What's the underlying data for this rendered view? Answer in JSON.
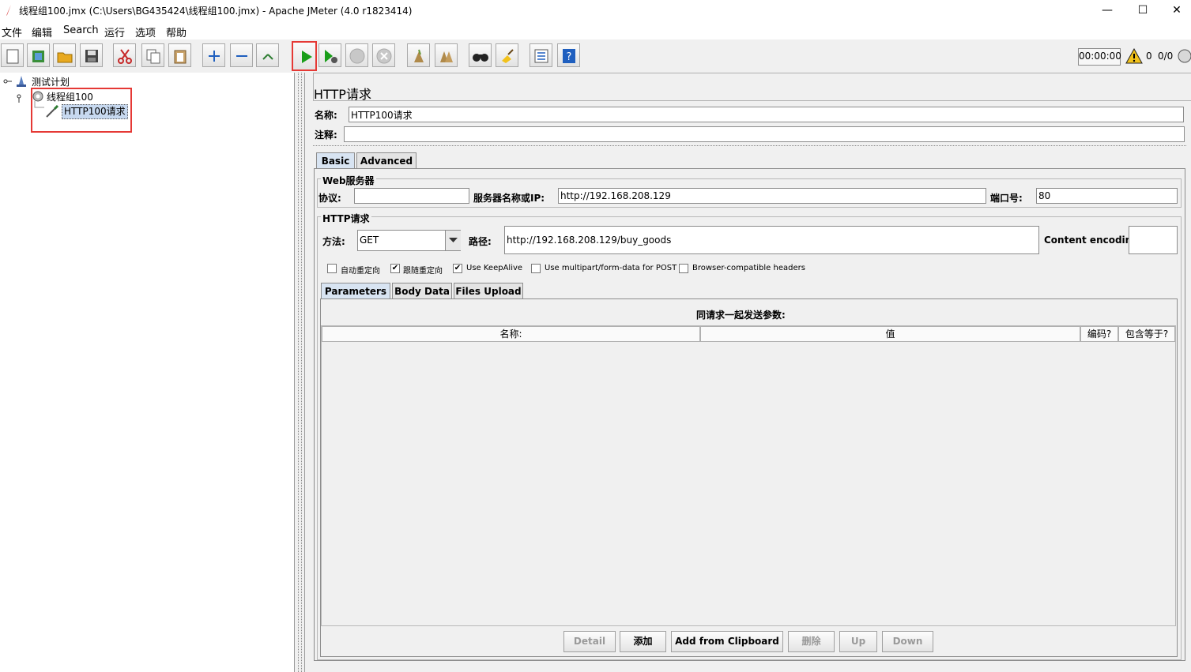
{
  "window": {
    "title": "线程组100.jmx (C:\\Users\\BG435424\\线程组100.jmx) - Apache JMeter (4.0 r1823414)",
    "minimize": "—",
    "maximize": "☐",
    "close": "✕"
  },
  "menu": [
    "文件",
    "编辑",
    "Search",
    "运行",
    "选项",
    "帮助"
  ],
  "toolbar": {
    "timer": "00:00:00",
    "warnings": "0",
    "threads": "0/0"
  },
  "tree": {
    "root": "测试计划",
    "thread_group": "线程组100",
    "sampler": "HTTP100请求"
  },
  "panel": {
    "title": "HTTP请求",
    "name_label": "名称:",
    "name_value": "HTTP100请求",
    "comment_label": "注释:",
    "comment_value": "",
    "tabs": [
      "Basic",
      "Advanced"
    ]
  },
  "web_server": {
    "section": "Web服务器",
    "protocol_label": "协议:",
    "protocol_value": "",
    "server_label": "服务器名称或IP:",
    "server_value": "http://192.168.208.129",
    "port_label": "端口号:",
    "port_value": "80"
  },
  "http_request": {
    "section": "HTTP请求",
    "method_label": "方法:",
    "method_value": "GET",
    "path_label": "路径:",
    "path_value": "http://192.168.208.129/buy_goods",
    "encoding_label": "Content encoding:",
    "encoding_value": "",
    "options": [
      {
        "label": "自动重定向",
        "checked": false
      },
      {
        "label": "跟随重定向",
        "checked": true
      },
      {
        "label": "Use KeepAlive",
        "checked": true
      },
      {
        "label": "Use multipart/form-data for POST",
        "checked": false
      },
      {
        "label": "Browser-compatible headers",
        "checked": false
      }
    ],
    "check_mark": "✔"
  },
  "params": {
    "tabs": [
      "Parameters",
      "Body Data",
      "Files Upload"
    ],
    "heading": "同请求一起发送参数:",
    "columns": [
      "名称:",
      "值",
      "编码?",
      "包含等于?"
    ]
  },
  "buttons": {
    "detail": "Detail",
    "add": "添加",
    "add_clipboard": "Add from Clipboard",
    "delete": "删除",
    "up": "Up",
    "down": "Down"
  },
  "colors": {
    "highlight_box": "#e53935",
    "selection": "#c7d9f0",
    "run_green": "#1a9e1a"
  }
}
